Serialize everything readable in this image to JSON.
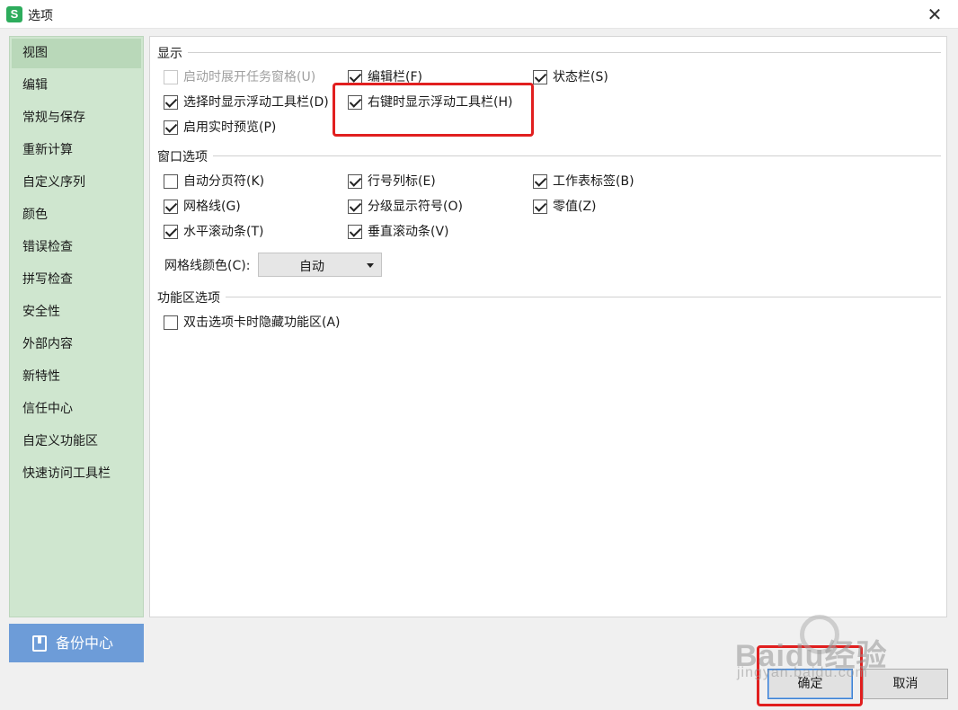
{
  "window": {
    "app_icon": "S",
    "title": "选项",
    "close_glyph": "✕"
  },
  "sidebar": {
    "items": [
      {
        "label": "视图",
        "active": true
      },
      {
        "label": "编辑"
      },
      {
        "label": "常规与保存"
      },
      {
        "label": "重新计算"
      },
      {
        "label": "自定义序列"
      },
      {
        "label": "颜色"
      },
      {
        "label": "错误检查"
      },
      {
        "label": "拼写检查"
      },
      {
        "label": "安全性"
      },
      {
        "label": "外部内容"
      },
      {
        "label": "新特性"
      },
      {
        "label": "信任中心"
      },
      {
        "label": "自定义功能区"
      },
      {
        "label": "快速访问工具栏"
      }
    ],
    "backup_label": "备份中心"
  },
  "sections": {
    "display": {
      "title": "显示",
      "options": [
        {
          "label": "启动时展开任务窗格(U)",
          "checked": false,
          "disabled": true
        },
        {
          "label": "编辑栏(F)",
          "checked": true
        },
        {
          "label": "状态栏(S)",
          "checked": true
        },
        {
          "label": "选择时显示浮动工具栏(D)",
          "checked": true
        },
        {
          "label": "右键时显示浮动工具栏(H)",
          "checked": true
        },
        {
          "label": "启用实时预览(P)",
          "checked": true
        }
      ]
    },
    "window": {
      "title": "窗口选项",
      "options": [
        {
          "label": "自动分页符(K)",
          "checked": false
        },
        {
          "label": "行号列标(E)",
          "checked": true
        },
        {
          "label": "工作表标签(B)",
          "checked": true
        },
        {
          "label": "网格线(G)",
          "checked": true
        },
        {
          "label": "分级显示符号(O)",
          "checked": true
        },
        {
          "label": "零值(Z)",
          "checked": true
        },
        {
          "label": "水平滚动条(T)",
          "checked": true
        },
        {
          "label": "垂直滚动条(V)",
          "checked": true
        }
      ],
      "grid_color_label": "网格线颜色(C):",
      "grid_color_value": "自动"
    },
    "ribbon": {
      "title": "功能区选项",
      "options": [
        {
          "label": "双击选项卡时隐藏功能区(A)",
          "checked": false
        }
      ]
    }
  },
  "buttons": {
    "ok": "确定",
    "cancel": "取消"
  },
  "watermark": {
    "main": "Baidu经验",
    "sub": "jingyan.baidu.com"
  },
  "colors": {
    "sidebar_bg": "#cfe6cf",
    "sidebar_active": "#b9d8b9",
    "backup_bg": "#6d9cd8",
    "highlight_red": "#e11f1f",
    "app_icon_green": "#2dac5c"
  }
}
